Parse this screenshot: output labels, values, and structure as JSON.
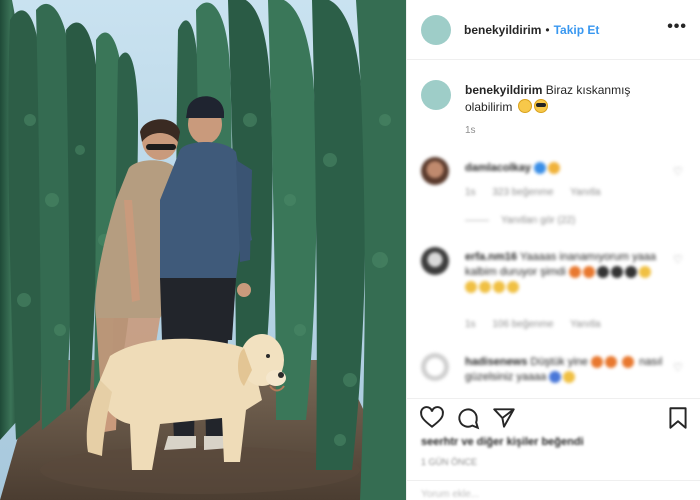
{
  "header": {
    "username": "benekyildirim",
    "separator": "•",
    "follow_label": "Takip Et",
    "more_icon": "ellipsis-icon",
    "more_label": "•••"
  },
  "caption": {
    "username": "benekyildirim",
    "text": "Biraz kıskanmış olabilirim",
    "time": "1s"
  },
  "comments": [
    {
      "username": "damlacolkay",
      "text": "",
      "time": "1s",
      "likes": "323 beğenme",
      "reply": "Yanıtla",
      "view_replies": "Yanıtları gör (22)"
    },
    {
      "username": "erfa.nm16",
      "text": "Yaaaas inanamıyorum yaaa kalbim duruyor şimdi",
      "time": "1s",
      "likes": "106 beğenme",
      "reply": "Yanıtla"
    },
    {
      "username": "hadisenews",
      "text": "Düştük yine",
      "text2": "nasıl güzelsiniz yaaaa"
    }
  ],
  "actions": {
    "like_icon": "heart-icon",
    "comment_icon": "comment-icon",
    "share_icon": "share-icon",
    "save_icon": "bookmark-icon"
  },
  "likes_text": "seerhtr ve diğer kişiler beğendi",
  "post_time": "1 GÜN ÖNCE",
  "add_comment_placeholder": "Yorum ekle...",
  "colors": {
    "accent": "#3897f0",
    "avatar": "#9ecdc8",
    "muted": "#8e8e8e"
  }
}
